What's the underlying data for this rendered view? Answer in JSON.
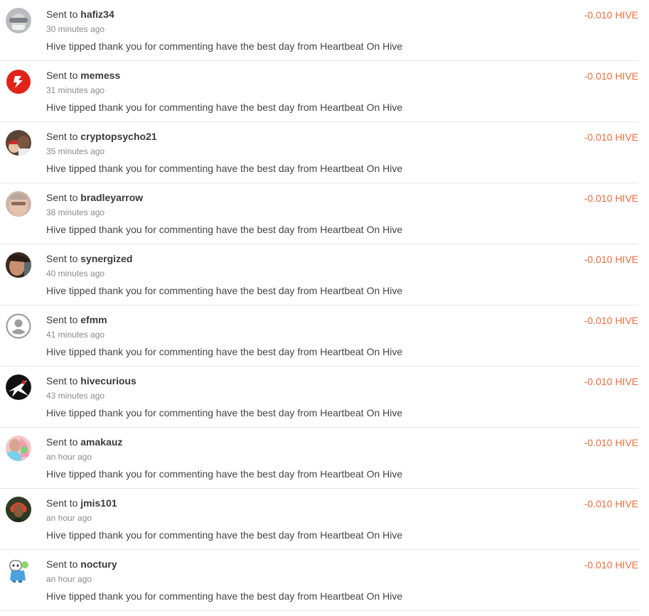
{
  "transfers": [
    {
      "prefix": "Sent to",
      "user": "hafiz34",
      "time": "30 minutes ago",
      "memo": "Hive tipped thank you for commenting have the best day from Heartbeat On Hive",
      "amount": "-0.010 HIVE",
      "avatar": "avatar-photo-grey"
    },
    {
      "prefix": "Sent to",
      "user": "memess",
      "time": "31 minutes ago",
      "memo": "Hive tipped thank you for commenting have the best day from Heartbeat On Hive",
      "amount": "-0.010 HIVE",
      "avatar": "avatar-red-logo"
    },
    {
      "prefix": "Sent to",
      "user": "cryptopsycho21",
      "time": "35 minutes ago",
      "memo": "Hive tipped thank you for commenting have the best day from Heartbeat On Hive",
      "amount": "-0.010 HIVE",
      "avatar": "avatar-photo-couple"
    },
    {
      "prefix": "Sent to",
      "user": "bradleyarrow",
      "time": "38 minutes ago",
      "memo": "Hive tipped thank you for commenting have the best day from Heartbeat On Hive",
      "amount": "-0.010 HIVE",
      "avatar": "avatar-photo-face"
    },
    {
      "prefix": "Sent to",
      "user": "synergized",
      "time": "40 minutes ago",
      "memo": "Hive tipped thank you for commenting have the best day from Heartbeat On Hive",
      "amount": "-0.010 HIVE",
      "avatar": "avatar-photo-face-dark"
    },
    {
      "prefix": "Sent to",
      "user": "efmm",
      "time": "41 minutes ago",
      "memo": "Hive tipped thank you for commenting have the best day from Heartbeat On Hive",
      "amount": "-0.010 HIVE",
      "avatar": "default-user-icon"
    },
    {
      "prefix": "Sent to",
      "user": "hivecurious",
      "time": "43 minutes ago",
      "memo": "Hive tipped thank you for commenting have the best day from Heartbeat On Hive",
      "amount": "-0.010 HIVE",
      "avatar": "avatar-black-star"
    },
    {
      "prefix": "Sent to",
      "user": "amakauz",
      "time": "an hour ago",
      "memo": "Hive tipped thank you for commenting have the best day from Heartbeat On Hive",
      "amount": "-0.010 HIVE",
      "avatar": "avatar-photo-colorful"
    },
    {
      "prefix": "Sent to",
      "user": "jmis101",
      "time": "an hour ago",
      "memo": "Hive tipped thank you for commenting have the best day from Heartbeat On Hive",
      "amount": "-0.010 HIVE",
      "avatar": "avatar-photo-woman"
    },
    {
      "prefix": "Sent to",
      "user": "noctury",
      "time": "an hour ago",
      "memo": "Hive tipped thank you for commenting have the best day from Heartbeat On Hive",
      "amount": "-0.010 HIVE",
      "avatar": "avatar-cartoon"
    }
  ],
  "colors": {
    "amount": "#f26b3a",
    "divider": "#e6e6e6",
    "time": "#8a8a8a"
  }
}
